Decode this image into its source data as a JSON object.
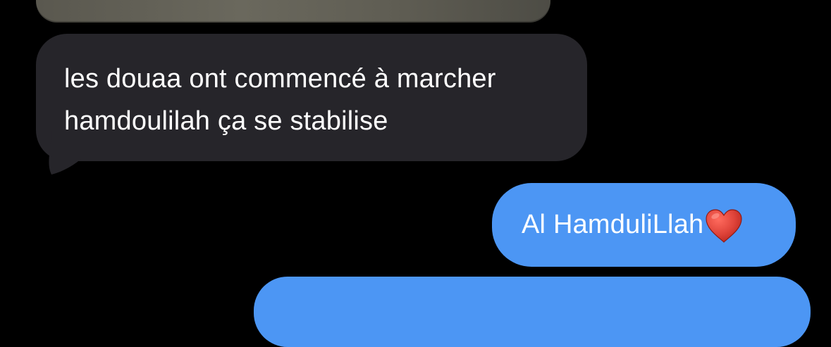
{
  "conversation": {
    "messages": [
      {
        "direction": "received",
        "type": "image",
        "text": ""
      },
      {
        "direction": "received",
        "type": "text",
        "lines": [
          "les douaa ont commencé à marcher",
          "hamdoulilah ça se stabilise"
        ]
      },
      {
        "direction": "sent",
        "type": "text",
        "text": "Al HamduliLlah",
        "emoji_icon": "red-heart-icon"
      },
      {
        "direction": "sent",
        "type": "text",
        "text": ""
      }
    ]
  },
  "colors": {
    "background": "#000000",
    "received_bubble": "#26252a",
    "sent_bubble": "#4c96f4",
    "text": "#ffffff",
    "heart": "#e0453b"
  }
}
